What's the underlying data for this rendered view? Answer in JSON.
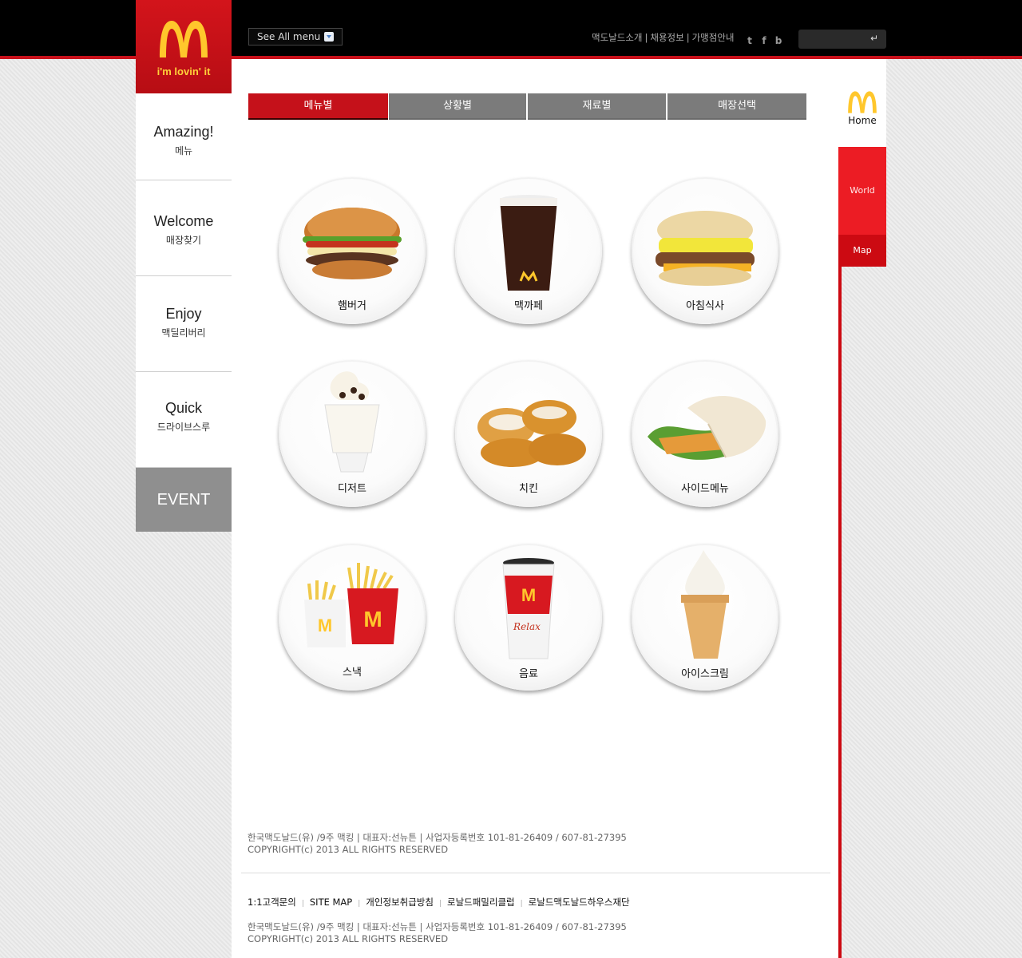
{
  "header": {
    "logo_slogan": "i'm lovin' it",
    "see_all_label": "See All menu",
    "top_links": [
      "맥도날드소개",
      "채용정보",
      "가맹점안내"
    ],
    "social_icons": [
      "twitter-icon",
      "facebook-icon",
      "blog-icon"
    ],
    "search_placeholder": ""
  },
  "leftnav": {
    "items": [
      {
        "en": "Amazing!",
        "ko": "메뉴"
      },
      {
        "en": "Welcome",
        "ko": "매장찾기"
      },
      {
        "en": "Enjoy",
        "ko": "맥딜리버리"
      },
      {
        "en": "Quick",
        "ko": "드라이브스루"
      }
    ],
    "event_label": "EVENT"
  },
  "tabs": [
    "메뉴별",
    "상황별",
    "재료별",
    "매장선택"
  ],
  "menu": [
    "햄버거",
    "맥까페",
    "아침식사",
    "디저트",
    "치킨",
    "사이드메뉴",
    "스낵",
    "음료",
    "아이스크림"
  ],
  "rightnav": {
    "home_label": "Home",
    "world_label": "World",
    "map_label": "Map"
  },
  "footer": {
    "info_line1": "한국맥도날드(유) /9주 맥킹  |  대표자:선뉴튼  |  사업자등록번호 101-81-26409 / 607-81-27395",
    "info_line2": "COPYRIGHT(c) 2013 ALL RIGHTS RESERVED",
    "links": [
      "1:1고객문의",
      "SITE MAP",
      "개인정보취급방침",
      "로날드패밀리클럽",
      "로날드맥도날드하우스재단"
    ]
  },
  "colors": {
    "brand_red": "#c5111a",
    "brand_yellow": "#ffc72c",
    "tab_gray": "#7b7b7b"
  }
}
